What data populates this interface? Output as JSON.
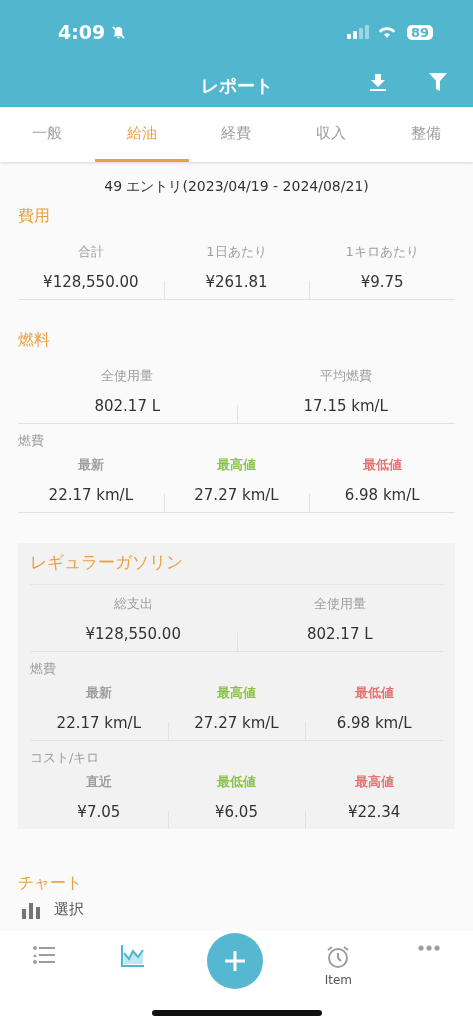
{
  "status_bar": {
    "time": "4:09",
    "battery": "89"
  },
  "header": {
    "title": "レポート"
  },
  "tabs": [
    {
      "label": "一般",
      "selected": false
    },
    {
      "label": "給油",
      "selected": true
    },
    {
      "label": "経費",
      "selected": false
    },
    {
      "label": "収入",
      "selected": false
    },
    {
      "label": "整備",
      "selected": false
    }
  ],
  "entries": "49 エントリ(2023/04/19 - 2024/08/21)",
  "sections": [
    {
      "kind": "plain",
      "title": "費用",
      "groups": [
        {
          "stats": [
            {
              "label": "合計",
              "value": "¥128,550.00",
              "color": "#9e9e9e"
            },
            {
              "label": "1日あたり",
              "value": "¥261.81",
              "color": "#9e9e9e"
            },
            {
              "label": "1キロあたり",
              "value": "¥9.75",
              "color": "#9e9e9e"
            }
          ]
        }
      ]
    },
    {
      "kind": "plain",
      "title": "燃料",
      "groups": [
        {
          "stats": [
            {
              "label": "全使用量",
              "value": "802.17 L",
              "color": "#9e9e9e"
            },
            {
              "label": "平均燃費",
              "value": "17.15 km/L",
              "color": "#9e9e9e"
            }
          ]
        },
        {
          "caption": "燃費",
          "stats": [
            {
              "label": "最新",
              "value": "22.17 km/L",
              "color": "#9e9e9e"
            },
            {
              "label": "最高値",
              "value": "27.27 km/L",
              "color": "#8bc34a"
            },
            {
              "label": "最低値",
              "value": "6.98 km/L",
              "color": "#e57373"
            }
          ]
        }
      ]
    },
    {
      "kind": "card",
      "title": "レギュラーガソリン",
      "groups": [
        {
          "stats": [
            {
              "label": "総支出",
              "value": "¥128,550.00",
              "color": "#9e9e9e"
            },
            {
              "label": "全使用量",
              "value": "802.17 L",
              "color": "#9e9e9e"
            }
          ]
        },
        {
          "caption": "燃費",
          "stats": [
            {
              "label": "最新",
              "value": "22.17 km/L",
              "color": "#9e9e9e"
            },
            {
              "label": "最高値",
              "value": "27.27 km/L",
              "color": "#8bc34a"
            },
            {
              "label": "最低値",
              "value": "6.98 km/L",
              "color": "#e57373"
            }
          ]
        },
        {
          "caption": "コスト/キロ",
          "stats": [
            {
              "label": "直近",
              "value": "¥7.05",
              "color": "#9e9e9e"
            },
            {
              "label": "最低値",
              "value": "¥6.05",
              "color": "#8bc34a"
            },
            {
              "label": "最高値",
              "value": "¥22.34",
              "color": "#e57373"
            }
          ]
        }
      ]
    }
  ],
  "chart": {
    "title": "チャート",
    "select": "選択"
  },
  "bottom_nav": [
    {
      "kind": "list",
      "selected": false
    },
    {
      "kind": "chart",
      "selected": true
    },
    {
      "kind": "add",
      "selected": false
    },
    {
      "kind": "alarm",
      "label": "Item",
      "selected": false
    },
    {
      "kind": "more",
      "selected": false
    }
  ]
}
